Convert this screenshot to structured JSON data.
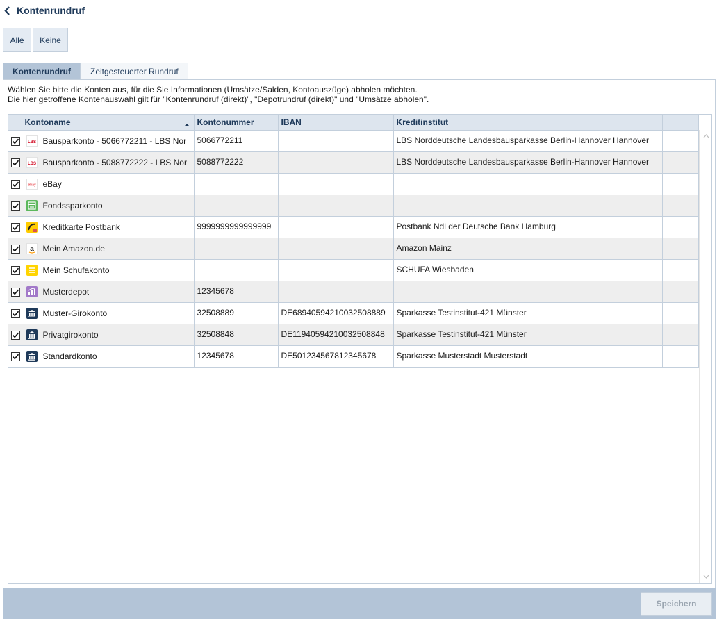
{
  "header": {
    "title": "Kontenrundruf"
  },
  "selection": {
    "all_label": "Alle",
    "none_label": "Keine"
  },
  "tabs": [
    {
      "label": "Kontenrundruf",
      "active": true
    },
    {
      "label": "Zeitgesteuerter Rundruf",
      "active": false
    }
  ],
  "intro": {
    "line1": "Wählen Sie bitte die Konten aus, für die Sie Informationen (Umsätze/Salden, Kontoauszüge) abholen möchten.",
    "line2": "Die hier getroffene Kontenauswahl gilt für \"Kontenrundruf (direkt)\", \"Depotrundruf (direkt)\" und \"Umsätze abholen\"."
  },
  "table": {
    "columns": {
      "name": "Kontoname",
      "number": "Kontonummer",
      "iban": "IBAN",
      "institute": "Kreditinstitut"
    },
    "sort": {
      "column": "Kontoname",
      "direction": "ascending"
    },
    "rows": [
      {
        "checked": true,
        "icon": "lbs-icon",
        "icon_text": "LBS",
        "name": "Bausparkonto - 5066772211 - LBS Nor",
        "number": "5066772211",
        "iban": "",
        "institute": "LBS Norddeutsche Landesbausparkasse Berlin-Hannover Hannover"
      },
      {
        "checked": true,
        "icon": "lbs-icon",
        "icon_text": "LBS",
        "name": "Bausparkonto - 5088772222 - LBS Nor",
        "number": "5088772222",
        "iban": "",
        "institute": "LBS Norddeutsche Landesbausparkasse Berlin-Hannover Hannover"
      },
      {
        "checked": true,
        "icon": "ebay-icon",
        "icon_text": "ebay",
        "name": "eBay",
        "number": "",
        "iban": "",
        "institute": ""
      },
      {
        "checked": true,
        "icon": "fund-icon",
        "icon_text": "",
        "name": "Fondssparkonto",
        "number": "",
        "iban": "",
        "institute": ""
      },
      {
        "checked": true,
        "icon": "creditcard-icon",
        "icon_text": "",
        "name": "Kreditkarte Postbank",
        "number": "9999999999999999",
        "iban": "",
        "institute": "Postbank Ndl der Deutsche Bank Hamburg"
      },
      {
        "checked": true,
        "icon": "amazon-icon",
        "icon_text": "a",
        "name": "Mein Amazon.de",
        "number": "",
        "iban": "",
        "institute": "Amazon Mainz"
      },
      {
        "checked": true,
        "icon": "schufa-icon",
        "icon_text": "",
        "name": "Mein Schufakonto",
        "number": "",
        "iban": "",
        "institute": "SCHUFA Wiesbaden"
      },
      {
        "checked": true,
        "icon": "depot-icon",
        "icon_text": "",
        "name": "Musterdepot",
        "number": "12345678",
        "iban": "",
        "institute": ""
      },
      {
        "checked": true,
        "icon": "bank-icon",
        "icon_text": "",
        "name": "Muster-Girokonto",
        "number": "32508889",
        "iban": "DE68940594210032508889",
        "institute": "Sparkasse Testinstitut-421 Münster"
      },
      {
        "checked": true,
        "icon": "bank-icon",
        "icon_text": "",
        "name": "Privatgirokonto",
        "number": "32508848",
        "iban": "DE11940594210032508848",
        "institute": "Sparkasse Testinstitut-421 Münster"
      },
      {
        "checked": true,
        "icon": "bank-icon",
        "icon_text": "",
        "name": "Standardkonto",
        "number": "12345678",
        "iban": "DE501234567812345678",
        "institute": "Sparkasse Musterstadt Musterstadt"
      }
    ]
  },
  "footer": {
    "save_label": "Speichern",
    "save_enabled": false
  },
  "colors": {
    "accent": "#1f3a5a",
    "header_bg": "#dde5ee",
    "footer_bg": "#b3c4d7",
    "row_alt": "#eeeeee"
  }
}
